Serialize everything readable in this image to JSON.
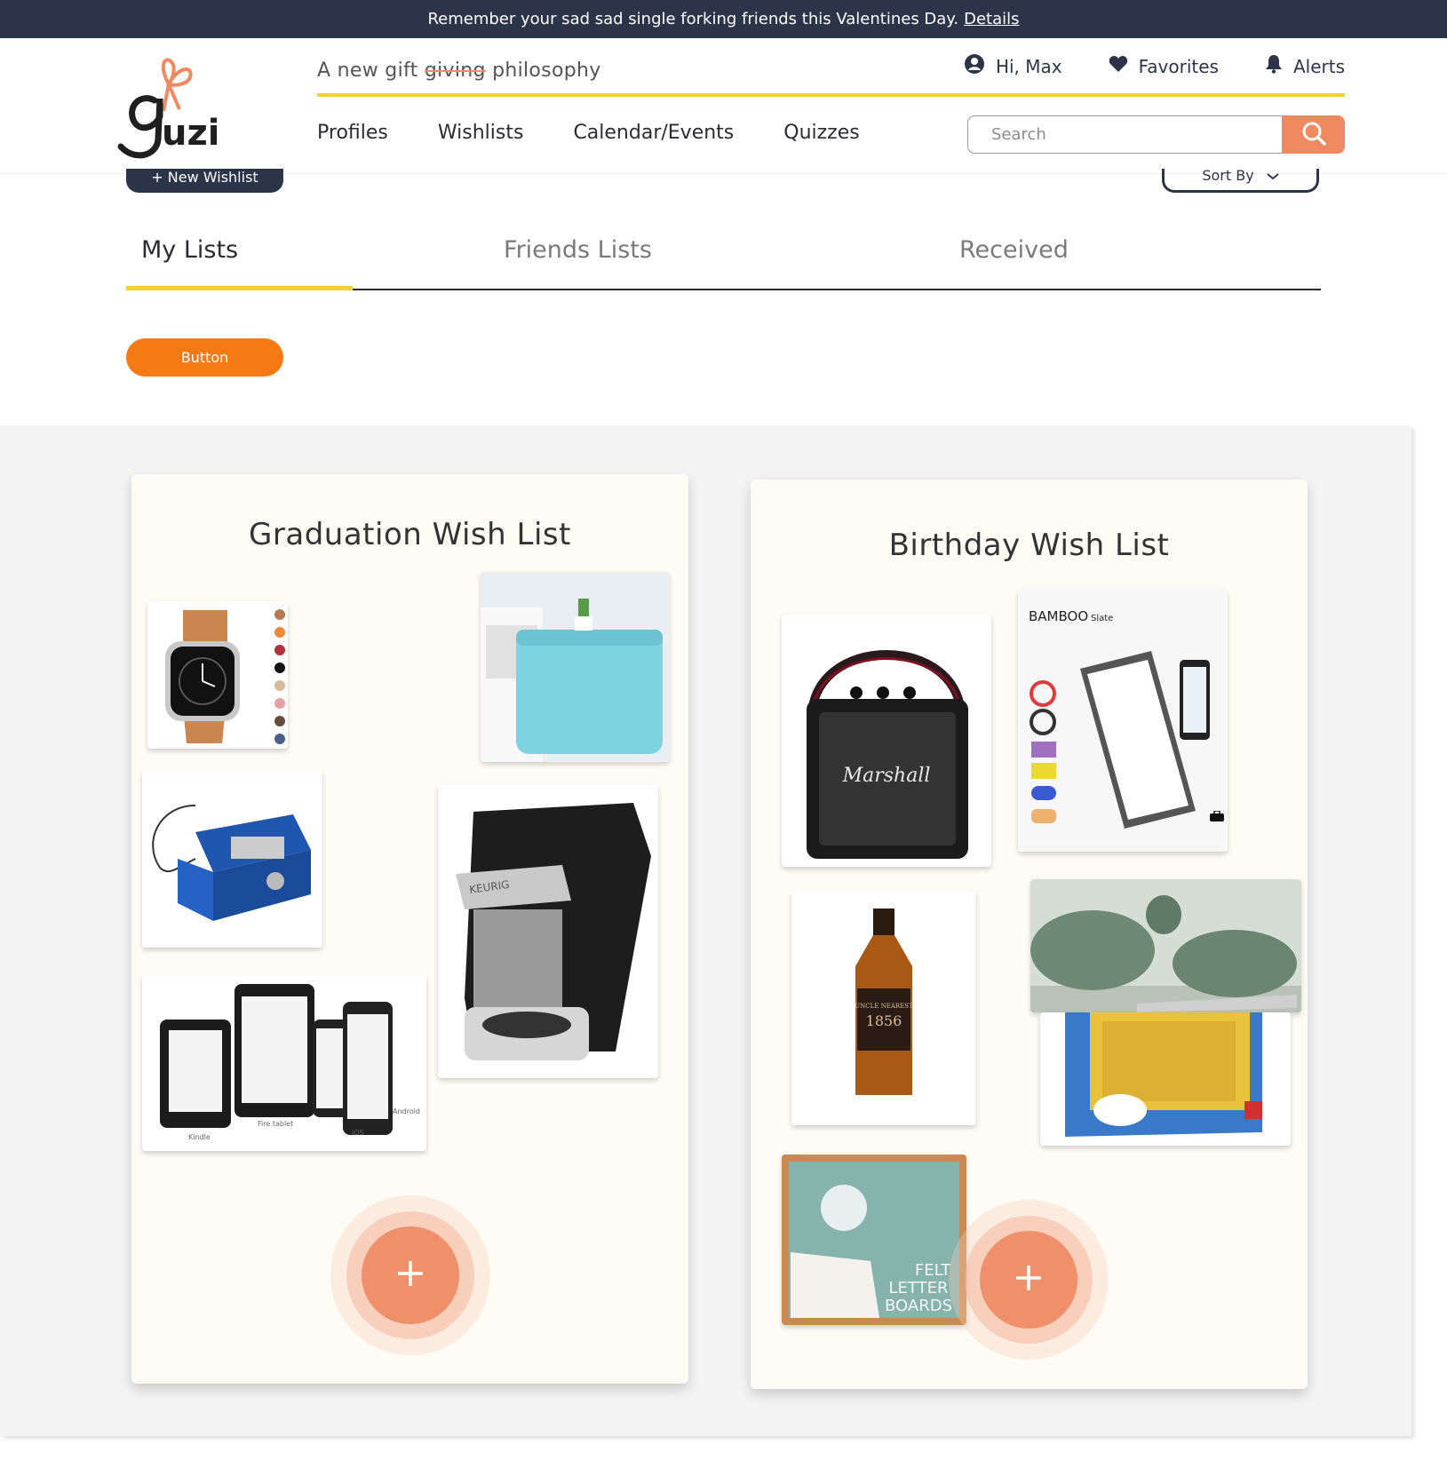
{
  "banner": {
    "message": "Remember your sad sad single forking friends this Valentines Day.",
    "link": "Details"
  },
  "brand": {
    "logo_text": "uzi",
    "logo_letter": "g"
  },
  "tagline": {
    "before": "A new gift ",
    "strike": "giving",
    "after": " philosophy"
  },
  "user_nav": {
    "greeting": "Hi, Max",
    "favorites": "Favorites",
    "alerts": "Alerts"
  },
  "nav": {
    "items": [
      "Profiles",
      "Wishlists",
      "Calendar/Events",
      "Quizzes"
    ]
  },
  "search": {
    "placeholder": "Search"
  },
  "actions": {
    "new_wishlist": "+ New Wishlist",
    "sort_by": "Sort By",
    "button": "Button"
  },
  "tabs": [
    {
      "label": "My Lists",
      "active": true
    },
    {
      "label": "Friends Lists",
      "active": false
    },
    {
      "label": "Received",
      "active": false
    }
  ],
  "wishlists": [
    {
      "title": "Graduation Wish List",
      "items": [
        "apple-watch",
        "mini-fridge",
        "lock-box",
        "keurig-coffee-maker",
        "kindle-devices"
      ]
    },
    {
      "title": "Birthday Wish List",
      "items": [
        "marshall-speaker",
        "bamboo-slate",
        "uncle-nearest-whiskey",
        "cookware-set",
        "simpsons-puzzle",
        "felt-letter-board"
      ]
    }
  ],
  "product_text": {
    "marshall": "Marshall",
    "bamboo": "BAMBOO",
    "slate": "Slate",
    "whiskey_line1": "UNCLE NEAREST",
    "whiskey_line2": "1856",
    "felt1": "FELT",
    "felt2": "LETTER",
    "felt3": "BOARDS",
    "kindle_labels": [
      "Kindle",
      "Fire tablet",
      "iOS",
      "Android"
    ],
    "keurig": "KEURIG"
  },
  "colors": {
    "navy": "#2c3449",
    "accent_orange": "#f0895f",
    "yellow": "#f5d22a",
    "button_orange": "#f57a14"
  }
}
